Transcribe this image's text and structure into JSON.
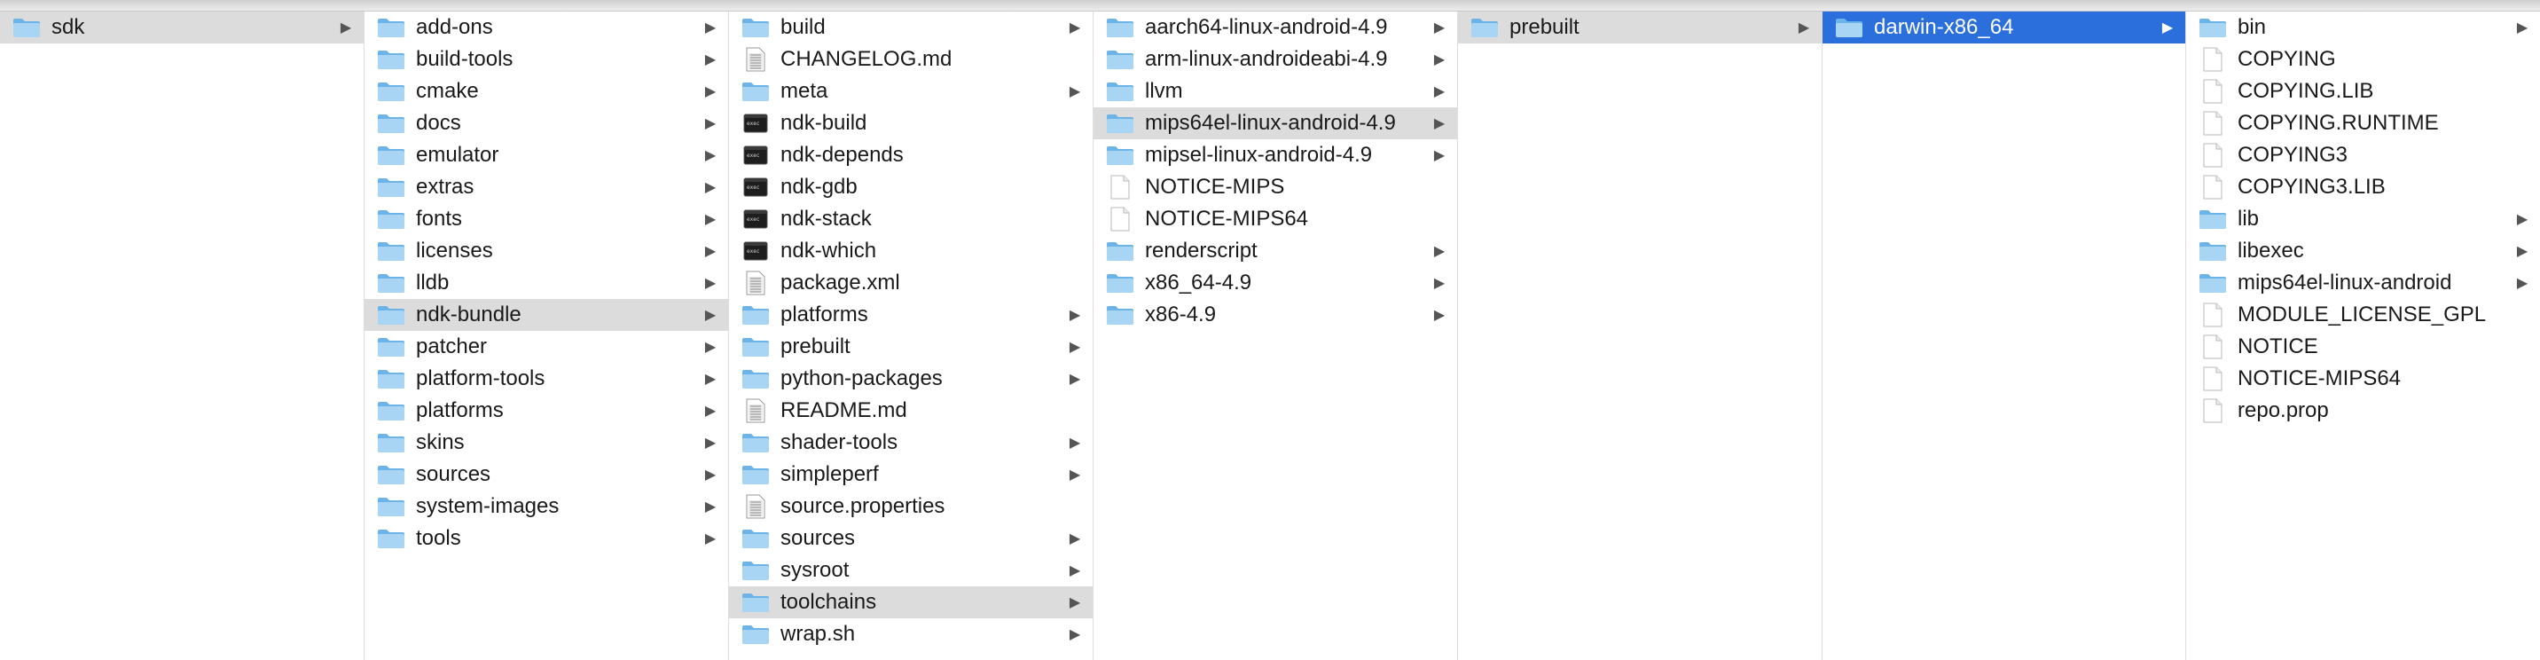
{
  "colors": {
    "folder_light": "#a9d5f4",
    "folder_dark": "#6cb4e8",
    "selection_inactive": "#dcdcdc",
    "selection_active": "#2a6fdb"
  },
  "columns": [
    {
      "items": [
        {
          "label": "sdk",
          "type": "folder",
          "arrow": true,
          "selected": "inactive"
        }
      ]
    },
    {
      "items": [
        {
          "label": "add-ons",
          "type": "folder",
          "arrow": true
        },
        {
          "label": "build-tools",
          "type": "folder",
          "arrow": true
        },
        {
          "label": "cmake",
          "type": "folder",
          "arrow": true
        },
        {
          "label": "docs",
          "type": "folder",
          "arrow": true
        },
        {
          "label": "emulator",
          "type": "folder",
          "arrow": true
        },
        {
          "label": "extras",
          "type": "folder",
          "arrow": true
        },
        {
          "label": "fonts",
          "type": "folder",
          "arrow": true
        },
        {
          "label": "licenses",
          "type": "folder",
          "arrow": true
        },
        {
          "label": "lldb",
          "type": "folder",
          "arrow": true
        },
        {
          "label": "ndk-bundle",
          "type": "folder",
          "arrow": true,
          "selected": "inactive"
        },
        {
          "label": "patcher",
          "type": "folder",
          "arrow": true
        },
        {
          "label": "platform-tools",
          "type": "folder",
          "arrow": true
        },
        {
          "label": "platforms",
          "type": "folder",
          "arrow": true
        },
        {
          "label": "skins",
          "type": "folder",
          "arrow": true
        },
        {
          "label": "sources",
          "type": "folder",
          "arrow": true
        },
        {
          "label": "system-images",
          "type": "folder",
          "arrow": true
        },
        {
          "label": "tools",
          "type": "folder",
          "arrow": true
        }
      ]
    },
    {
      "items": [
        {
          "label": "build",
          "type": "folder",
          "arrow": true
        },
        {
          "label": "CHANGELOG.md",
          "type": "textfile",
          "arrow": false
        },
        {
          "label": "meta",
          "type": "folder",
          "arrow": true
        },
        {
          "label": "ndk-build",
          "type": "executable",
          "arrow": false
        },
        {
          "label": "ndk-depends",
          "type": "executable",
          "arrow": false
        },
        {
          "label": "ndk-gdb",
          "type": "executable",
          "arrow": false
        },
        {
          "label": "ndk-stack",
          "type": "executable",
          "arrow": false
        },
        {
          "label": "ndk-which",
          "type": "executable",
          "arrow": false
        },
        {
          "label": "package.xml",
          "type": "textfile",
          "arrow": false
        },
        {
          "label": "platforms",
          "type": "folder",
          "arrow": true
        },
        {
          "label": "prebuilt",
          "type": "folder",
          "arrow": true
        },
        {
          "label": "python-packages",
          "type": "folder",
          "arrow": true
        },
        {
          "label": "README.md",
          "type": "textfile",
          "arrow": false
        },
        {
          "label": "shader-tools",
          "type": "folder",
          "arrow": true
        },
        {
          "label": "simpleperf",
          "type": "folder",
          "arrow": true
        },
        {
          "label": "source.properties",
          "type": "textfile",
          "arrow": false
        },
        {
          "label": "sources",
          "type": "folder",
          "arrow": true
        },
        {
          "label": "sysroot",
          "type": "folder",
          "arrow": true
        },
        {
          "label": "toolchains",
          "type": "folder",
          "arrow": true,
          "selected": "inactive"
        },
        {
          "label": "wrap.sh",
          "type": "folder",
          "arrow": true
        }
      ]
    },
    {
      "items": [
        {
          "label": "aarch64-linux-android-4.9",
          "type": "folder",
          "arrow": true
        },
        {
          "label": "arm-linux-androideabi-4.9",
          "type": "folder",
          "arrow": true
        },
        {
          "label": "llvm",
          "type": "folder",
          "arrow": true
        },
        {
          "label": "mips64el-linux-android-4.9",
          "type": "folder",
          "arrow": true,
          "selected": "inactive"
        },
        {
          "label": "mipsel-linux-android-4.9",
          "type": "folder",
          "arrow": true
        },
        {
          "label": "NOTICE-MIPS",
          "type": "blankfile",
          "arrow": false
        },
        {
          "label": "NOTICE-MIPS64",
          "type": "blankfile",
          "arrow": false
        },
        {
          "label": "renderscript",
          "type": "folder",
          "arrow": true
        },
        {
          "label": "x86_64-4.9",
          "type": "folder",
          "arrow": true
        },
        {
          "label": "x86-4.9",
          "type": "folder",
          "arrow": true
        }
      ]
    },
    {
      "items": [
        {
          "label": "prebuilt",
          "type": "folder",
          "arrow": true,
          "selected": "inactive"
        }
      ]
    },
    {
      "items": [
        {
          "label": "darwin-x86_64",
          "type": "folder",
          "arrow": true,
          "selected": "active"
        }
      ]
    },
    {
      "items": [
        {
          "label": "bin",
          "type": "folder",
          "arrow": true
        },
        {
          "label": "COPYING",
          "type": "blankfile",
          "arrow": false
        },
        {
          "label": "COPYING.LIB",
          "type": "blankfile",
          "arrow": false
        },
        {
          "label": "COPYING.RUNTIME",
          "type": "blankfile",
          "arrow": false
        },
        {
          "label": "COPYING3",
          "type": "blankfile",
          "arrow": false
        },
        {
          "label": "COPYING3.LIB",
          "type": "blankfile",
          "arrow": false
        },
        {
          "label": "lib",
          "type": "folder",
          "arrow": true
        },
        {
          "label": "libexec",
          "type": "folder",
          "arrow": true
        },
        {
          "label": "mips64el-linux-android",
          "type": "folder",
          "arrow": true
        },
        {
          "label": "MODULE_LICENSE_GPL",
          "type": "blankfile",
          "arrow": false
        },
        {
          "label": "NOTICE",
          "type": "blankfile",
          "arrow": false
        },
        {
          "label": "NOTICE-MIPS64",
          "type": "blankfile",
          "arrow": false
        },
        {
          "label": "repo.prop",
          "type": "blankfile",
          "arrow": false
        }
      ]
    }
  ]
}
